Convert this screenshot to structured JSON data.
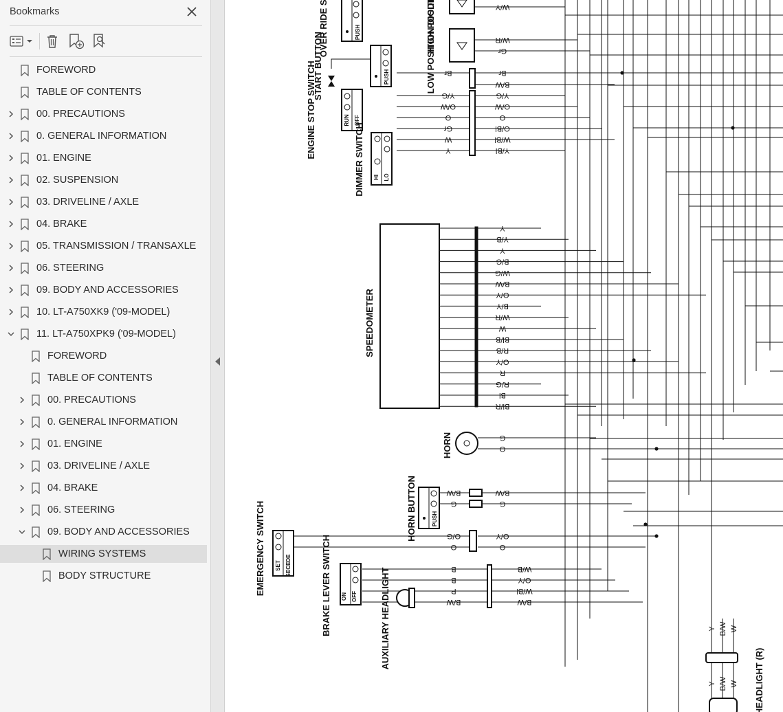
{
  "bookmarks_panel": {
    "title": "Bookmarks",
    "close_icon": "close-icon",
    "toolbar": {
      "options_icon": "list-options-icon",
      "delete_icon": "trash-icon",
      "new_bookmark_icon": "add-bookmark-icon",
      "find_bookmark_icon": "find-bookmark-icon"
    },
    "items": [
      {
        "label": "FOREWORD",
        "level": 0,
        "expandable": false,
        "expanded": false
      },
      {
        "label": "TABLE OF CONTENTS",
        "level": 0,
        "expandable": false,
        "expanded": false
      },
      {
        "label": "00. PRECAUTIONS",
        "level": 0,
        "expandable": true,
        "expanded": false
      },
      {
        "label": "0. GENERAL INFORMATION",
        "level": 0,
        "expandable": true,
        "expanded": false
      },
      {
        "label": "01. ENGINE",
        "level": 0,
        "expandable": true,
        "expanded": false
      },
      {
        "label": "02. SUSPENSION",
        "level": 0,
        "expandable": true,
        "expanded": false
      },
      {
        "label": "03. DRIVELINE / AXLE",
        "level": 0,
        "expandable": true,
        "expanded": false
      },
      {
        "label": "04. BRAKE",
        "level": 0,
        "expandable": true,
        "expanded": false
      },
      {
        "label": "05. TRANSMISSION / TRANSAXLE",
        "level": 0,
        "expandable": true,
        "expanded": false
      },
      {
        "label": "06. STEERING",
        "level": 0,
        "expandable": true,
        "expanded": false
      },
      {
        "label": "09. BODY AND ACCESSORIES",
        "level": 0,
        "expandable": true,
        "expanded": false
      },
      {
        "label": "10. LT-A750XK9 ('09-MODEL)",
        "level": 0,
        "expandable": true,
        "expanded": false
      },
      {
        "label": "11. LT-A750XPK9 ('09-MODEL)",
        "level": 0,
        "expandable": true,
        "expanded": true
      },
      {
        "label": "FOREWORD",
        "level": 1,
        "expandable": false,
        "expanded": false
      },
      {
        "label": "TABLE OF CONTENTS",
        "level": 1,
        "expandable": false,
        "expanded": false
      },
      {
        "label": "00. PRECAUTIONS",
        "level": 1,
        "expandable": true,
        "expanded": false
      },
      {
        "label": "0. GENERAL INFORMATION",
        "level": 1,
        "expandable": true,
        "expanded": false
      },
      {
        "label": "01. ENGINE",
        "level": 1,
        "expandable": true,
        "expanded": false
      },
      {
        "label": "03. DRIVELINE / AXLE",
        "level": 1,
        "expandable": true,
        "expanded": false
      },
      {
        "label": "04. BRAKE",
        "level": 1,
        "expandable": true,
        "expanded": false
      },
      {
        "label": "06. STEERING",
        "level": 1,
        "expandable": true,
        "expanded": false
      },
      {
        "label": "09. BODY AND ACCESSORIES",
        "level": 1,
        "expandable": true,
        "expanded": true
      },
      {
        "label": "WIRING SYSTEMS",
        "level": 2,
        "expandable": false,
        "expanded": false,
        "selected": true
      },
      {
        "label": "BODY STRUCTURE",
        "level": 2,
        "expandable": false,
        "expanded": false
      }
    ]
  },
  "collapse_handle_icon": "collapse-left-icon",
  "diagram": {
    "components": {
      "over_ride_switch": "OVER RIDE SWITCH",
      "start_button": "START BUTTON",
      "engine_stop_switch": "ENGINE STOP SWITCH",
      "dimmer_switch": "DIMMER SWITCH",
      "high_position_diode": "HIGH POSITION DIODE",
      "low_position_diode": "LOW POSITION DIODE",
      "speedometer": "SPEEDOMETER",
      "horn": "HORN",
      "horn_button": "HORN BUTTON",
      "emergency_switch": "EMERGENCY SWITCH",
      "brake_lever_switch": "BRAKE LEVER SWITCH",
      "auxiliary_headlight": "AUXILIARY HEADLIGHT",
      "headlight_r": "HEADLIGHT (R)"
    },
    "switch_marks": {
      "push": "PUSH",
      "run": "RUN",
      "off": "OFF",
      "hi": "HI",
      "lo": "LO",
      "on": "ON",
      "set": "SET",
      "secede": "SECEDE"
    },
    "top_wires_left": [
      "Br",
      "Y/G",
      "O/W",
      "O",
      "Gr",
      "W",
      "Y"
    ],
    "top_wires_right": [
      "W/Y",
      "W/R",
      "Gr",
      "Br",
      "B/W",
      "Y/G",
      "O/W",
      "O",
      "O/Bl",
      "W/Bl",
      "Y/Bl"
    ],
    "speedometer_wires": [
      "Y",
      "Y/B",
      "Y",
      "B/G",
      "W/G",
      "B/W",
      "O/Y",
      "B/Y",
      "W/R",
      "W",
      "Bl/B",
      "R/B",
      "O/Y",
      "R",
      "R/G",
      "Bl",
      "Bl/R"
    ],
    "horn_wires": [
      "G",
      "O"
    ],
    "horn_button_left": [
      "B/W",
      "G"
    ],
    "horn_button_right": [
      "B/W",
      "G"
    ],
    "emergency_left": [
      "O/G",
      "O"
    ],
    "emergency_right": [
      "O/Y",
      "O"
    ],
    "brake_left": [
      "B",
      "B",
      "P",
      "B/W"
    ],
    "brake_right": [
      "W/B",
      "O/Y",
      "W/Bl",
      "B/W"
    ],
    "headlight_wires": [
      "Y",
      "B/W",
      "W"
    ]
  }
}
